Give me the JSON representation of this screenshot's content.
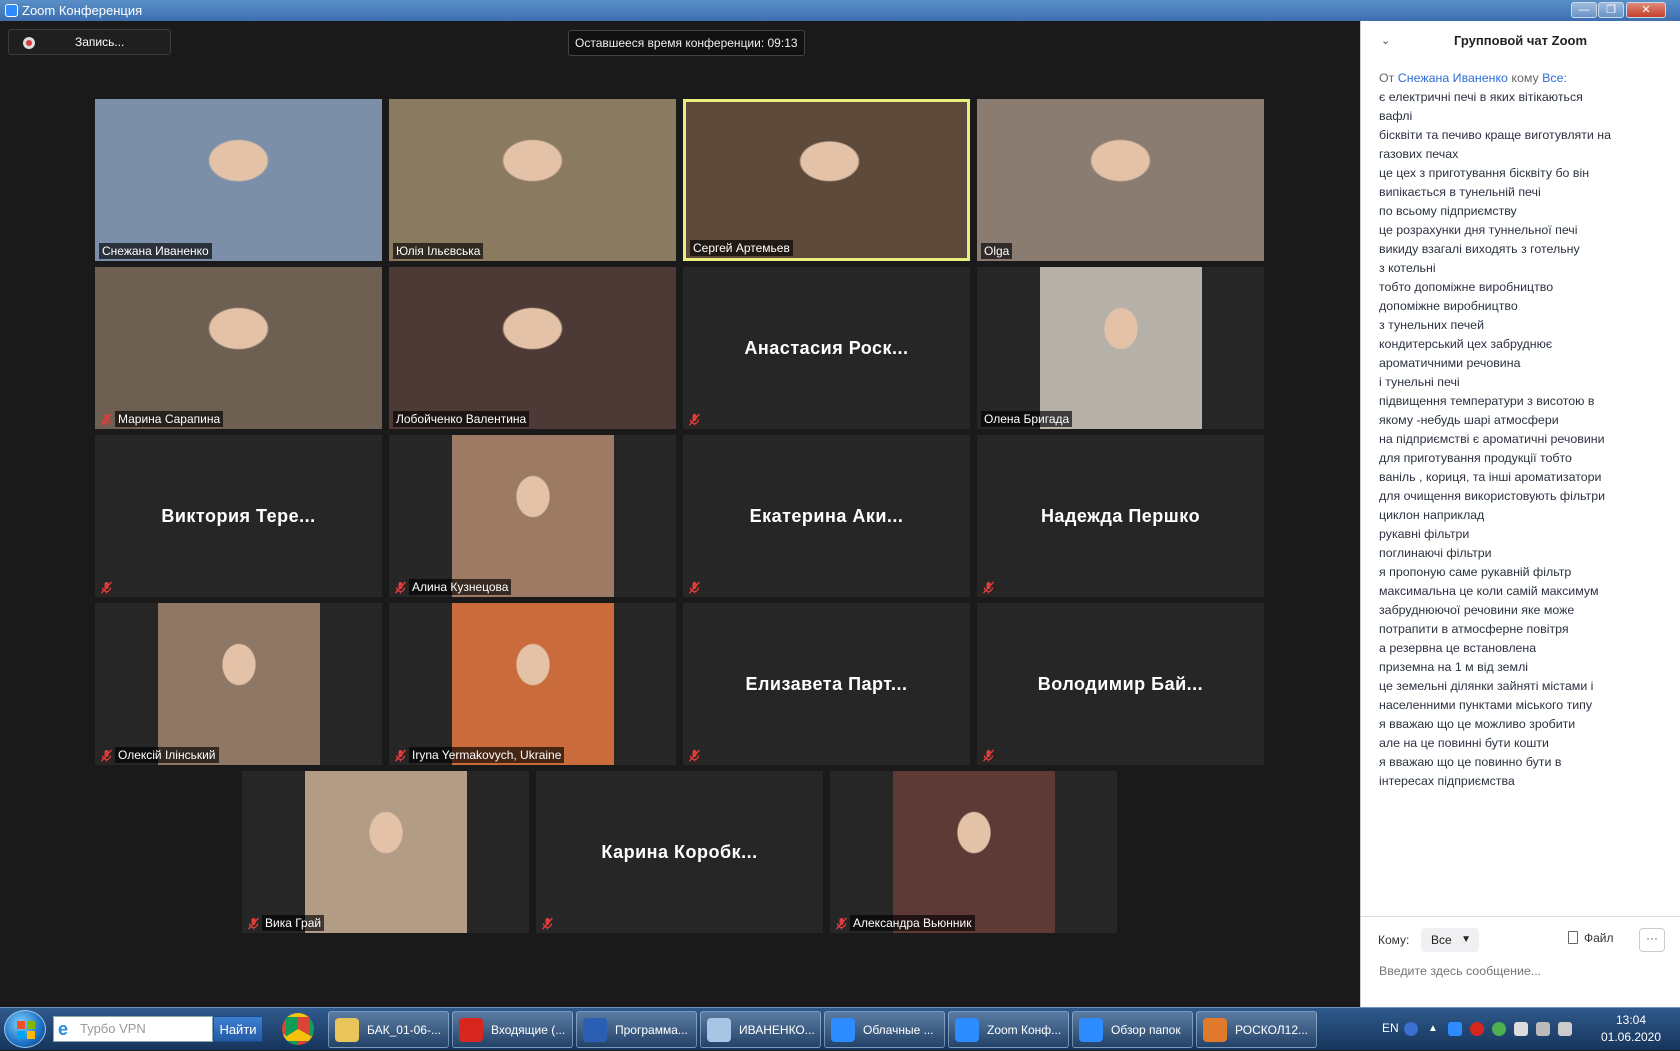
{
  "window": {
    "title": "Zoom Конференция",
    "btn_min": "—",
    "btn_max": "❐",
    "btn_close": "✕"
  },
  "toolbar": {
    "record_label": "Запись...",
    "time_left": "Оставшееся время конференции: 09:13"
  },
  "participants": [
    {
      "name": "Снежана Иваненко",
      "video": true,
      "muted": false,
      "active": false
    },
    {
      "name": "Юлія Ільєвська",
      "video": true,
      "muted": false,
      "active": false
    },
    {
      "name": "Сергей Артемьев",
      "video": true,
      "muted": false,
      "active": true
    },
    {
      "name": "Olga",
      "video": true,
      "muted": false,
      "active": false
    },
    {
      "name": "Марина Сарапина",
      "video": true,
      "muted": true,
      "active": false
    },
    {
      "name": "Лобойченко Валентина",
      "video": true,
      "muted": false,
      "active": false
    },
    {
      "name": "Анастасия  Роск...",
      "video": false,
      "muted": true,
      "active": false
    },
    {
      "name": "Олена Бригада",
      "video": true,
      "muted": false,
      "active": false
    },
    {
      "name": "Виктория  Тере...",
      "video": false,
      "muted": true,
      "active": false
    },
    {
      "name": "Алина Кузнецова",
      "video": true,
      "muted": true,
      "active": false
    },
    {
      "name": "Екатерина  Аки...",
      "video": false,
      "muted": true,
      "active": false
    },
    {
      "name": "Надежда Першко",
      "video": false,
      "muted": true,
      "active": false
    },
    {
      "name": "Олексій Ілінський",
      "video": true,
      "muted": true,
      "active": false
    },
    {
      "name": "Iryna Yermakovych, Ukraine",
      "video": true,
      "muted": true,
      "active": false
    },
    {
      "name": "Елизавета  Парт...",
      "video": false,
      "muted": true,
      "active": false
    },
    {
      "name": "Володимир  Бай...",
      "video": false,
      "muted": true,
      "active": false
    },
    {
      "name": "Вика Грай",
      "video": true,
      "muted": true,
      "active": false
    },
    {
      "name": "Карина  Коробк...",
      "video": false,
      "muted": true,
      "active": false
    },
    {
      "name": "Александра Вьюнник",
      "video": true,
      "muted": true,
      "active": false
    }
  ],
  "chat": {
    "title": "Групповой чат Zoom",
    "from_prefix": "От",
    "sender": "Снежана Иваненко",
    "to_word": "кому",
    "recipient": "Все:",
    "lines": [
      "є електричні печі в яких вітікаються",
      "вафлі",
      "бісквіти та печиво краще виготувляти на",
      "газових печах",
      "це цех з приготування бісквіту бо він",
      "випікається в тунельній печі",
      "по всьому підприємству",
      "це розрахунки дня туннельної печі",
      "викиду взагалі виходять з готельну",
      "з котельні",
      "тобто допоміжне виробництво",
      "допоміжне виробництво",
      "з тунельних печей",
      "кондитерський цех забруднює",
      "ароматичними речовина",
      "і тунельні печі",
      "підвищення температури з висотою в",
      "якому -небудь шарі атмосфери",
      "на підприємстві є ароматичні речовини",
      "для приготування продукції тобто",
      "ваніль , кориця, та інші ароматизатори",
      "для очищення використовують фільтри",
      "циклон наприклад",
      "рукавні фільтри",
      "поглинаючі фільтри",
      "я пропоную саме рукавній фільтр",
      "максимальна це коли самій максимум",
      "забруднюючої речовини яке може",
      "потрапити в атмосферне повітря",
      "а резервна це встановлена",
      "приземна на 1 м від землі",
      "це земельні ділянки зайняті містами і",
      "населенними пунктами міського типу",
      "я вважаю що це можливо зробити",
      "але на це повинні бути кошти",
      "я вважаю що це повинно бути в",
      "інтересах підприємства"
    ],
    "to_label": "Кому:",
    "to_value": "Все",
    "file_label": "Файл",
    "more_label": "···",
    "input_placeholder": "Введите здесь сообщение..."
  },
  "taskbar": {
    "search_placeholder": "Турбо VPN",
    "search_button": "Найти",
    "apps": [
      {
        "label": "БАК_01-06-...",
        "icon": "folder-icon",
        "color": "#e8c45a"
      },
      {
        "label": "Входящие (...",
        "icon": "opera-icon",
        "color": "#d8261f"
      },
      {
        "label": "Программа...",
        "icon": "word-icon",
        "color": "#2b5fb4"
      },
      {
        "label": "ИВАНЕНКО...",
        "icon": "paint-icon",
        "color": "#a7c6e6"
      },
      {
        "label": "Облачные ...",
        "icon": "zoom-icon",
        "color": "#2d8cff"
      },
      {
        "label": "Zoom Конф...",
        "icon": "zoom-icon",
        "color": "#2d8cff"
      },
      {
        "label": "Обзор папок",
        "icon": "zoom-icon",
        "color": "#2d8cff"
      },
      {
        "label": "РОСКОЛ12...",
        "icon": "eye-app-icon",
        "color": "#e07a2a"
      }
    ],
    "lang": "EN",
    "time": "13:04",
    "date": "01.06.2020"
  },
  "colors": {
    "active_speaker_border": "#e8ef7a",
    "chat_sender": "#2d6fd6",
    "tile_bg": "#262626",
    "meeting_bg": "#1a1a1a"
  }
}
